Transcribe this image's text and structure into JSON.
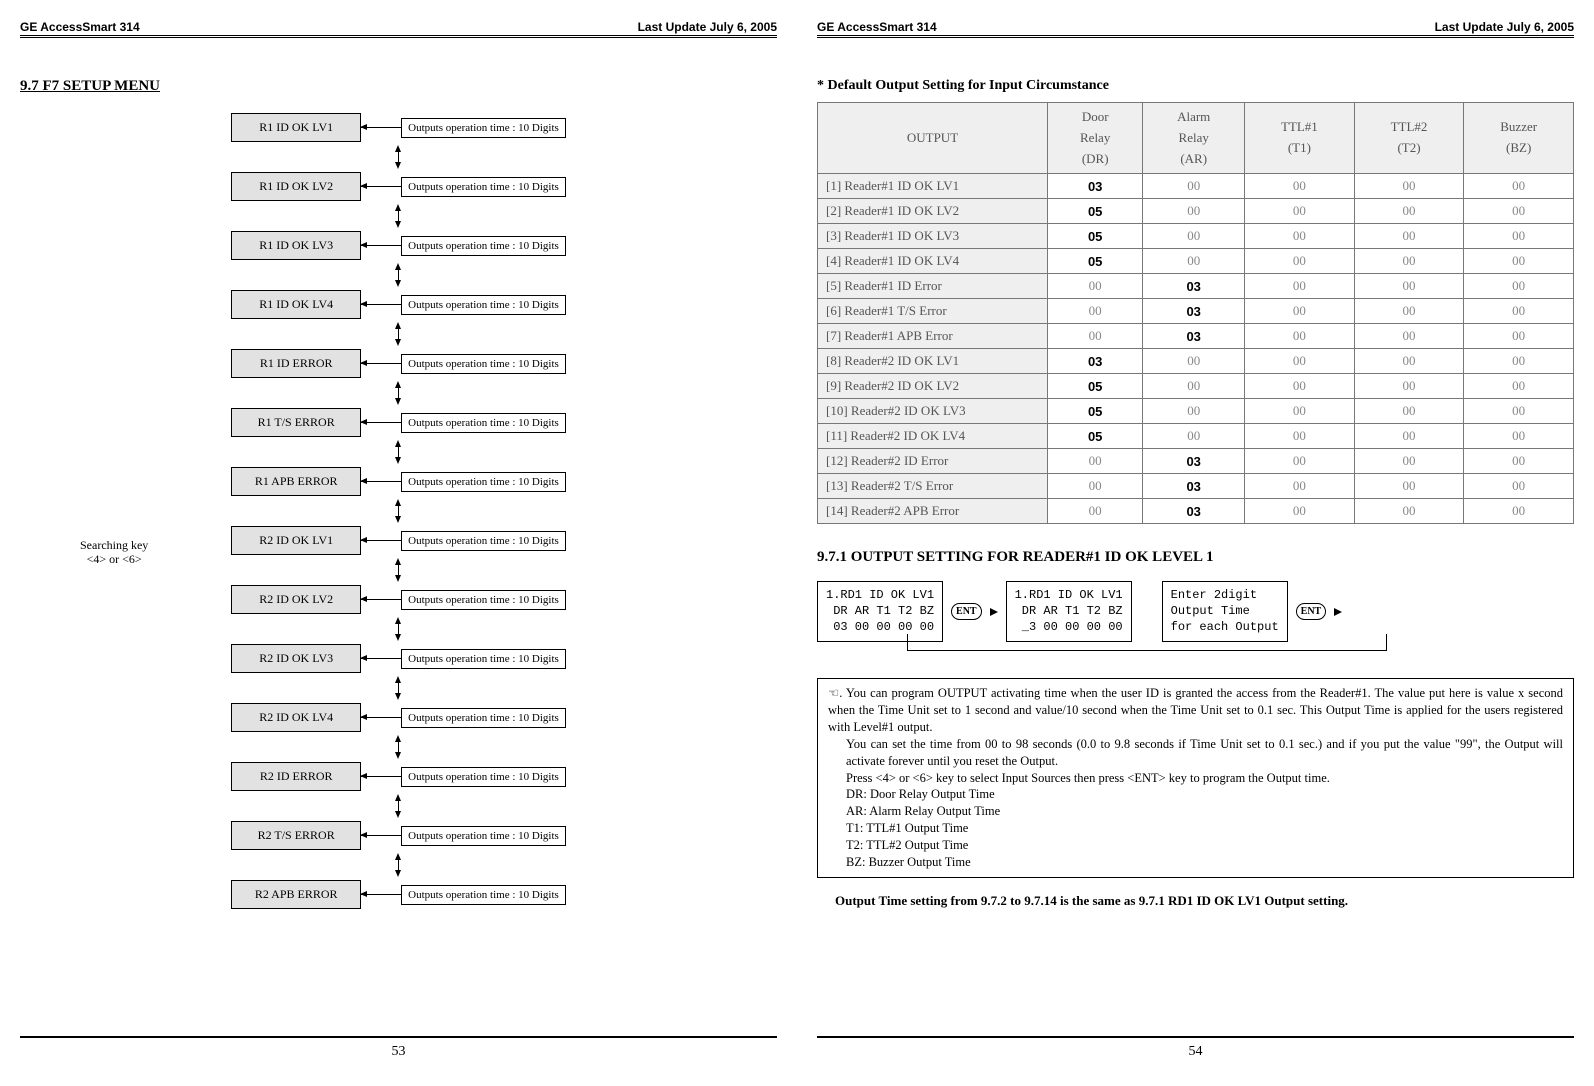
{
  "header": {
    "product": "GE AccessSmart 314",
    "updated": "Last Update July 6, 2005"
  },
  "left": {
    "title": "9.7 F7 SETUP MENU",
    "search_label_l1": "Searching key",
    "search_label_l2": "<4> or <6>",
    "desc": "Outputs operation time : 10 Digits",
    "nodes": {
      "n1": "R1 ID OK LV1",
      "n2": "R1 ID OK LV2",
      "n3": "R1 ID OK LV3",
      "n4": "R1 ID OK LV4",
      "n5": "R1 ID ERROR",
      "n6": "R1 T/S ERROR",
      "n7": "R1 APB ERROR",
      "n8": "R2 ID OK LV1",
      "n9": "R2 ID OK LV2",
      "n10": "R2 ID OK LV3",
      "n11": "R2 ID OK LV4",
      "n12": "R2 ID ERROR",
      "n13": "R2 T/S ERROR",
      "n14": "R2 APB ERROR"
    },
    "page_no": "53"
  },
  "right": {
    "caption": "* Default Output Setting for Input Circumstance",
    "table": {
      "head": {
        "output": "OUTPUT",
        "dr1": "Door",
        "dr2": "Relay",
        "dr3": "(DR)",
        "ar1": "Alarm",
        "ar2": "Relay",
        "ar3": "(AR)",
        "t1a": "TTL#1",
        "t1b": "(T1)",
        "t2a": "TTL#2",
        "t2b": "(T2)",
        "bz1": "Buzzer",
        "bz2": "(BZ)"
      },
      "rows": [
        {
          "lbl": "[1] Reader#1 ID OK LV1",
          "dr": "03",
          "ar": "00",
          "t1": "00",
          "t2": "00",
          "bz": "00",
          "b": "dr"
        },
        {
          "lbl": "[2] Reader#1 ID OK LV2",
          "dr": "05",
          "ar": "00",
          "t1": "00",
          "t2": "00",
          "bz": "00",
          "b": "dr"
        },
        {
          "lbl": "[3] Reader#1 ID OK LV3",
          "dr": "05",
          "ar": "00",
          "t1": "00",
          "t2": "00",
          "bz": "00",
          "b": "dr"
        },
        {
          "lbl": "[4] Reader#1 ID OK LV4",
          "dr": "05",
          "ar": "00",
          "t1": "00",
          "t2": "00",
          "bz": "00",
          "b": "dr"
        },
        {
          "lbl": "[5] Reader#1 ID Error",
          "dr": "00",
          "ar": "03",
          "t1": "00",
          "t2": "00",
          "bz": "00",
          "b": "ar"
        },
        {
          "lbl": "[6] Reader#1 T/S Error",
          "dr": "00",
          "ar": "03",
          "t1": "00",
          "t2": "00",
          "bz": "00",
          "b": "ar"
        },
        {
          "lbl": "[7] Reader#1 APB Error",
          "dr": "00",
          "ar": "03",
          "t1": "00",
          "t2": "00",
          "bz": "00",
          "b": "ar"
        },
        {
          "lbl": "[8] Reader#2 ID OK   LV1",
          "dr": "03",
          "ar": "00",
          "t1": "00",
          "t2": "00",
          "bz": "00",
          "b": "dr"
        },
        {
          "lbl": "[9] Reader#2 ID OK   LV2",
          "dr": "05",
          "ar": "00",
          "t1": "00",
          "t2": "00",
          "bz": "00",
          "b": "dr"
        },
        {
          "lbl": "[10] Reader#2 ID OK   LV3",
          "dr": "05",
          "ar": "00",
          "t1": "00",
          "t2": "00",
          "bz": "00",
          "b": "dr"
        },
        {
          "lbl": "[11] Reader#2 ID OK   LV4",
          "dr": "05",
          "ar": "00",
          "t1": "00",
          "t2": "00",
          "bz": "00",
          "b": "dr"
        },
        {
          "lbl": "[12] Reader#2 ID Error",
          "dr": "00",
          "ar": "03",
          "t1": "00",
          "t2": "00",
          "bz": "00",
          "b": "ar"
        },
        {
          "lbl": "[13] Reader#2 T/S Error",
          "dr": "00",
          "ar": "03",
          "t1": "00",
          "t2": "00",
          "bz": "00",
          "b": "ar"
        },
        {
          "lbl": "[14] Reader#2 APB Error",
          "dr": "00",
          "ar": "03",
          "t1": "00",
          "t2": "00",
          "bz": "00",
          "b": "ar"
        }
      ]
    },
    "sub": "9.7.1 OUTPUT SETTING FOR READER#1 ID OK LEVEL 1",
    "lcd1": "1.RD1 ID OK LV1\n DR AR T1 T2 BZ\n 03 00 00 00 00",
    "lcd2": "1.RD1 ID OK LV1\n DR AR T1 T2 BZ\n _3 00 00 00 00",
    "lcd3": "Enter 2digit\nOutput Time\nfor each Output",
    "ent": "ENT",
    "note_lead": "☜. You can program OUTPUT activating time when the user ID is granted the access from the Reader#1. The value put here is value x second when the Time Unit set to 1 second and value/10 second when the Time Unit set to 0.1 sec. This Output Time is applied for the users registered with Level#1 output.",
    "note_l2": "You can set the time from 00 to 98 seconds (0.0 to 9.8 seconds if Time Unit set to 0.1 sec.) and if you put the value \"99\", the Output will activate forever until you reset the Output.",
    "note_l3": "Press <4> or <6> key to select Input Sources then press <ENT> key to program the Output time.",
    "note_l4": "DR: Door Relay Output Time",
    "note_l5": "AR: Alarm Relay Output Time",
    "note_l6": "T1: TTL#1 Output Time",
    "note_l7": "T2: TTL#2 Output Time",
    "note_l8": "BZ: Buzzer Output Time",
    "final": "Output Time setting from 9.7.2 to 9.7.14 is the same as 9.7.1 RD1 ID OK LV1 Output setting.",
    "page_no": "54"
  },
  "chart_data": {
    "type": "table",
    "title": "Default Output Setting for Input Circumstance",
    "columns": [
      "OUTPUT",
      "Door Relay (DR)",
      "Alarm Relay (AR)",
      "TTL#1 (T1)",
      "TTL#2 (T2)",
      "Buzzer (BZ)"
    ],
    "rows": [
      [
        "[1] Reader#1 ID OK LV1",
        "03",
        "00",
        "00",
        "00",
        "00"
      ],
      [
        "[2] Reader#1 ID OK LV2",
        "05",
        "00",
        "00",
        "00",
        "00"
      ],
      [
        "[3] Reader#1 ID OK LV3",
        "05",
        "00",
        "00",
        "00",
        "00"
      ],
      [
        "[4] Reader#1 ID OK LV4",
        "05",
        "00",
        "00",
        "00",
        "00"
      ],
      [
        "[5] Reader#1 ID Error",
        "00",
        "03",
        "00",
        "00",
        "00"
      ],
      [
        "[6] Reader#1 T/S Error",
        "00",
        "03",
        "00",
        "00",
        "00"
      ],
      [
        "[7] Reader#1 APB Error",
        "00",
        "03",
        "00",
        "00",
        "00"
      ],
      [
        "[8] Reader#2 ID OK LV1",
        "03",
        "00",
        "00",
        "00",
        "00"
      ],
      [
        "[9] Reader#2 ID OK LV2",
        "05",
        "00",
        "00",
        "00",
        "00"
      ],
      [
        "[10] Reader#2 ID OK LV3",
        "05",
        "00",
        "00",
        "00",
        "00"
      ],
      [
        "[11] Reader#2 ID OK LV4",
        "05",
        "00",
        "00",
        "00",
        "00"
      ],
      [
        "[12] Reader#2 ID Error",
        "00",
        "03",
        "00",
        "00",
        "00"
      ],
      [
        "[13] Reader#2 T/S Error",
        "00",
        "03",
        "00",
        "00",
        "00"
      ],
      [
        "[14] Reader#2 APB Error",
        "00",
        "03",
        "00",
        "00",
        "00"
      ]
    ]
  }
}
